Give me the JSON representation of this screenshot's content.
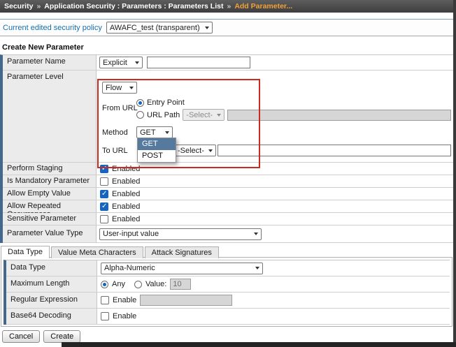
{
  "breadcrumb": {
    "separator": "»",
    "section": "Security",
    "path": "Application Security : Parameters : Parameters List",
    "current": "Add Parameter..."
  },
  "policy_bar": {
    "label": "Current edited security policy",
    "selected_policy": "AWAFC_test (transparent)"
  },
  "create_form": {
    "title": "Create New Parameter",
    "parameter_name": {
      "label": "Parameter Name",
      "type_select_value": "Explicit",
      "name_input_value": ""
    },
    "parameter_level": {
      "label": "Parameter Level",
      "level_select_value": "Flow",
      "from_url_label": "From URL",
      "entry_point": {
        "label": "Entry Point",
        "selected": true
      },
      "url_path": {
        "label": "URL Path",
        "selected": false,
        "select_value": "-Select-",
        "input_value": ""
      },
      "method_label": "Method",
      "method_select_value": "GET",
      "method_dropdown": {
        "options": [
          "GET",
          "POST"
        ],
        "highlighted": "GET"
      },
      "to_url_label": "To URL",
      "to_url_select_value": "-Select-",
      "to_url_input_value": ""
    },
    "checkbox_rows": [
      {
        "label": "Perform Staging",
        "option": "Enabled",
        "checked": true
      },
      {
        "label": "Is Mandatory Parameter",
        "option": "Enabled",
        "checked": false
      },
      {
        "label": "Allow Empty Value",
        "option": "Enabled",
        "checked": true
      },
      {
        "label": "Allow Repeated Occurrences",
        "option": "Enabled",
        "checked": true
      },
      {
        "label": "Sensitive Parameter",
        "option": "Enabled",
        "checked": false
      }
    ],
    "parameter_value_type": {
      "label": "Parameter Value Type",
      "select_value": "User-input value"
    }
  },
  "tabs": {
    "items": [
      "Data Type",
      "Value Meta Characters",
      "Attack Signatures"
    ],
    "active": "Data Type"
  },
  "data_type_panel": {
    "data_type": {
      "label": "Data Type",
      "select_value": "Alpha-Numeric"
    },
    "maximum_length": {
      "label": "Maximum Length",
      "any_option": "Any",
      "any_selected": true,
      "value_option": "Value:",
      "value_selected": false,
      "value_input": "10"
    },
    "regular_expression": {
      "label": "Regular Expression",
      "option": "Enable",
      "checked": false,
      "input_value": ""
    },
    "base64_decoding": {
      "label": "Base64 Decoding",
      "option": "Enable",
      "checked": false
    }
  },
  "footer": {
    "cancel_label": "Cancel",
    "create_label": "Create"
  },
  "colors": {
    "breadcrumb_bg": "#454545",
    "breadcrumb_current": "#f2a13c",
    "accent_left_bar": "#44688c",
    "annotation_red": "#cc2a1e",
    "checkbox_checked": "#1565c0",
    "dropdown_highlight": "#56799e"
  }
}
